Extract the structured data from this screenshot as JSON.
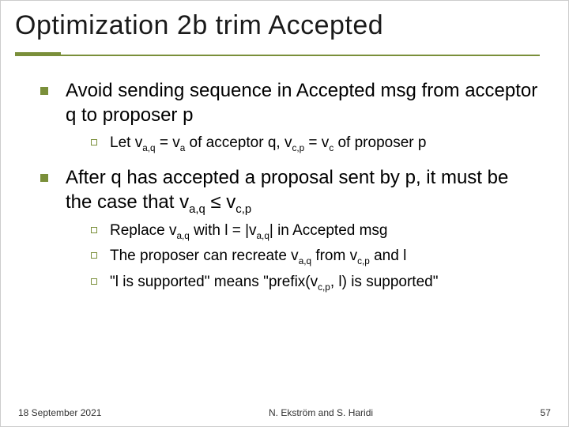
{
  "title": "Optimization 2b trim Accepted",
  "bullets": {
    "b1": "Avoid sending sequence in Accepted msg from acceptor q to proposer p",
    "b1a_pre": "Let v",
    "b1a_sub1": "a,q",
    "b1a_mid1": " = v",
    "b1a_sub2": "a",
    "b1a_mid2": " of acceptor q, v",
    "b1a_sub3": "c,p",
    "b1a_mid3": " = v",
    "b1a_sub4": "c",
    "b1a_end": " of proposer p",
    "b2_pre": "After q has accepted a proposal sent by p, it must be the case that v",
    "b2_sub1": "a,q",
    "b2_mid": " ≤ v",
    "b2_sub2": "c,p",
    "b2a_pre": "Replace v",
    "b2a_sub1": "a,q",
    "b2a_mid1": " with l = |v",
    "b2a_sub2": "a,q",
    "b2a_end": "| in Accepted msg",
    "b2b_pre": "The proposer can recreate v",
    "b2b_sub1": "a,q",
    "b2b_mid": " from v",
    "b2b_sub2": "c,p",
    "b2b_end": " and l",
    "b2c_pre": "\"l is supported\" means \"prefix(v",
    "b2c_sub1": "c,p",
    "b2c_end": ", l) is supported\""
  },
  "footer": {
    "date": "18 September 2021",
    "authors": "N. Ekström and S. Haridi",
    "page": "57"
  }
}
